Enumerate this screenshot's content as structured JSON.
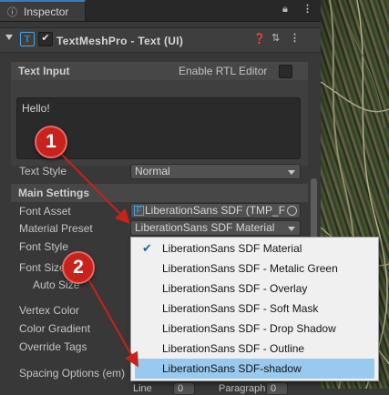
{
  "window": {
    "tab_title": "Inspector"
  },
  "component": {
    "title": "TextMeshPro - Text (UI)"
  },
  "text_input": {
    "section_title": "Text Input",
    "rtl_label": "Enable RTL Editor",
    "text_value": "Hello!"
  },
  "text_style": {
    "label": "Text Style",
    "value": "Normal"
  },
  "main_settings": {
    "section_title": "Main Settings",
    "font_asset_label": "Font Asset",
    "font_asset_value": "LiberationSans SDF (TMP_F",
    "material_preset_label": "Material Preset",
    "material_preset_value": "LiberationSans SDF Material",
    "font_style_label": "Font Style",
    "font_size_label": "Font Size",
    "auto_size_label": "Auto Size",
    "vertex_color_label": "Vertex Color",
    "color_gradient_label": "Color Gradient",
    "override_tags_label": "Override Tags",
    "spacing_options_label": "Spacing Options (em)",
    "spacing_sub_1": "Line",
    "spacing_sub_1_value": "0",
    "spacing_sub_2": "Paragraph",
    "spacing_sub_2_value": "0"
  },
  "dropdown": {
    "options": [
      "LiberationSans SDF Material",
      "LiberationSans SDF - Metalic Green",
      "LiberationSans SDF - Overlay",
      "LiberationSans SDF - Soft Mask",
      "LiberationSans SDF - Drop Shadow",
      "LiberationSans SDF - Outline",
      "LiberationSans SDF-shadow"
    ],
    "checked_index": 0,
    "highlighted_index": 6
  },
  "callouts": {
    "one": "1",
    "two": "2"
  },
  "colors": {
    "accent": "#3a79bb",
    "callout": "#c8221c",
    "highlight": "#99c9ef"
  }
}
